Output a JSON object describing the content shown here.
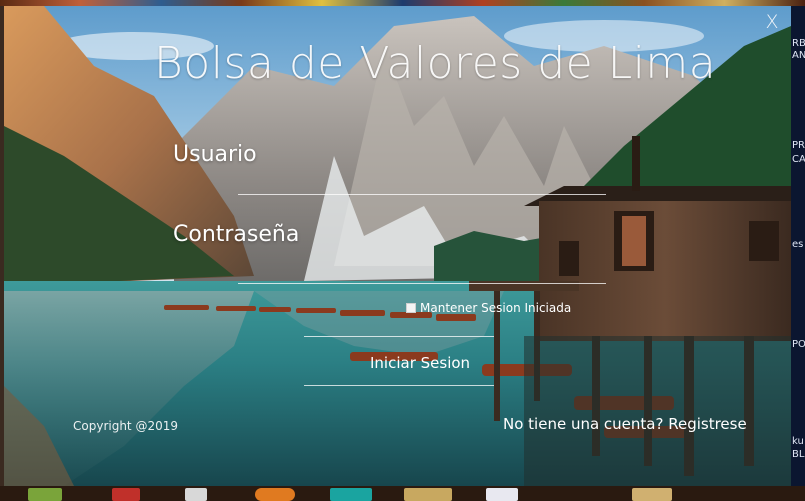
{
  "dialog": {
    "title": "Bolsa de Valores de Lima",
    "close_label": "X"
  },
  "form": {
    "username_label": "Usuario",
    "password_label": "Contraseña",
    "remember_label": "Mantener Sesion Iniciada",
    "remember_checked": false,
    "login_label": "Iniciar Sesion"
  },
  "footer": {
    "copyright": "Copyright @2019",
    "register_link": "No tiene una cuenta? Registrese"
  },
  "desktop_right_labels": [
    "RBU",
    "AN",
    "PR",
    "CA",
    "es",
    "PO",
    "ku",
    "BL"
  ],
  "colors": {
    "sky": "#7fb4dc",
    "lake": "#2f8a8f",
    "forest": "#1e4a2c",
    "cabin": "#5a3a28"
  },
  "background": "alpine lake with wooden boathouse and rowboats, mountain peaks"
}
